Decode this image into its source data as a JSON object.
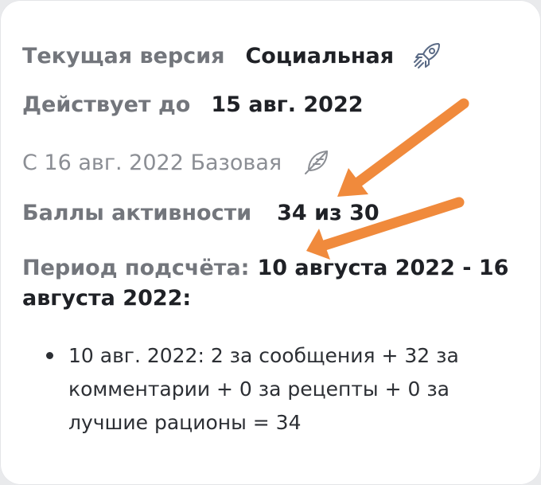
{
  "version": {
    "label": "Текущая версия",
    "value": "Социальная",
    "icon": "rocket-icon"
  },
  "valid_until": {
    "label": "Действует до",
    "value": "15 авг. 2022"
  },
  "next_version": {
    "text": "С 16 авг. 2022 Базовая",
    "icon": "feather-icon"
  },
  "activity": {
    "label": "Баллы активности",
    "value": "34 из 30"
  },
  "period": {
    "label": "Период подсчёта:",
    "value": "10 августа 2022 - 16 августа 2022:"
  },
  "breakdown": [
    {
      "text": "10 авг. 2022: 2 за сообщения + 32 за комментарии + 0 за рецепты + 0 за лучшие рационы = 34"
    }
  ],
  "colors": {
    "arrow": "#f08a3c",
    "label": "#73767c",
    "value": "#1f2126",
    "icon": "#5b6b86"
  }
}
